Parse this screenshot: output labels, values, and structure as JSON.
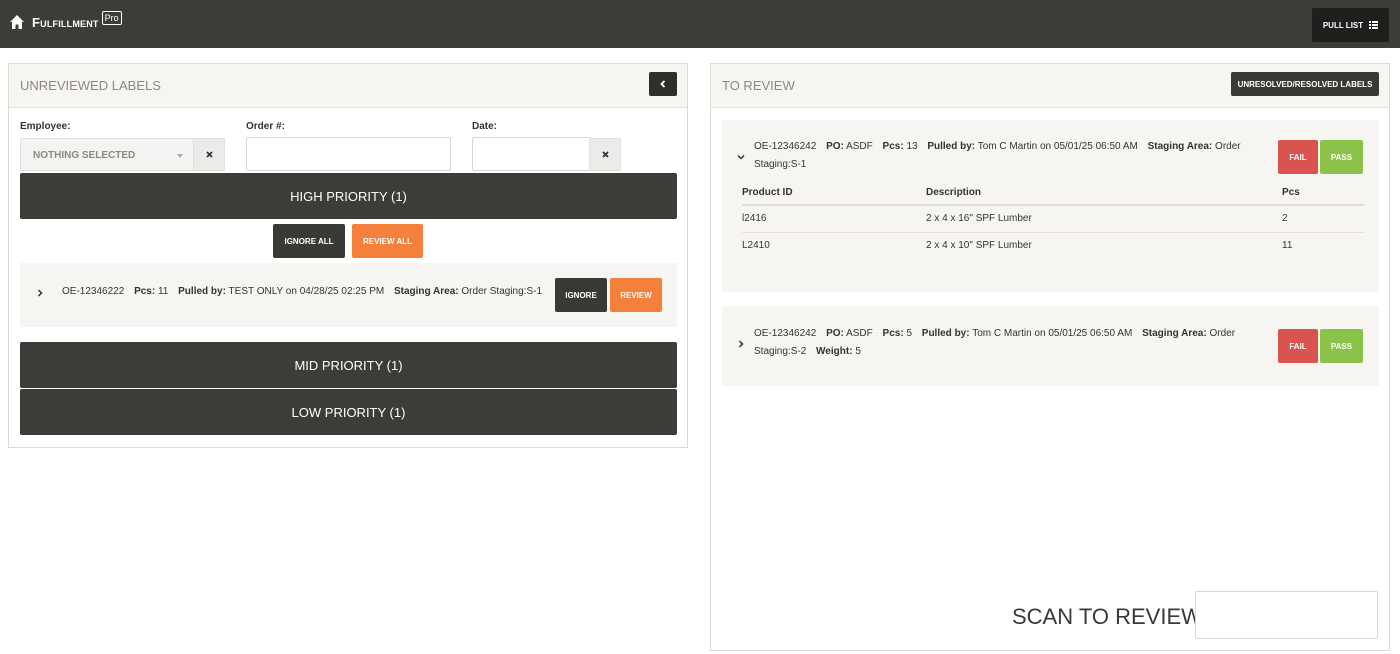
{
  "header": {
    "app_name": "Fulfillment",
    "badge": "Pro",
    "pull_list_label": "PULL LIST",
    "home_icon": "home-icon",
    "list_icon": "list-icon"
  },
  "unreviewed": {
    "title": "UNREVIEWED LABELS",
    "filters": {
      "employee_label": "Employee:",
      "employee_value": "NOTHING SELECTED",
      "order_label": "Order #:",
      "order_value": "",
      "date_label": "Date:",
      "date_value": ""
    },
    "high": {
      "label": "HIGH PRIORITY (1)",
      "ignore_all": "IGNORE ALL",
      "review_all": "REVIEW ALL",
      "items": [
        {
          "order": "OE-12346222",
          "pcs_label": "Pcs:",
          "pcs": "11",
          "pulled_label": "Pulled by:",
          "pulled": "TEST ONLY on 04/28/25 02:25 PM",
          "staging_label": "Staging Area:",
          "staging": "Order Staging:S-1",
          "ignore": "IGNORE",
          "review": "REVIEW"
        }
      ]
    },
    "mid": {
      "label": "MID PRIORITY (1)"
    },
    "low": {
      "label": "LOW PRIORITY (1)"
    }
  },
  "to_review": {
    "title": "TO REVIEW",
    "unresolved_button": "UNRESOLVED/RESOLVED LABELS",
    "items": [
      {
        "order": "OE-12346242",
        "po_label": "PO:",
        "po": "ASDF",
        "pcs_label": "Pcs:",
        "pcs": "13",
        "pulled_label": "Pulled by:",
        "pulled": "Tom C Martin on 05/01/25 06:50 AM",
        "staging_label": "Staging Area:",
        "staging_a": "Order",
        "staging_b": "Staging:S-1",
        "fail": "FAIL",
        "pass": "PASS",
        "table": {
          "headers": [
            "Product ID",
            "Description",
            "Pcs"
          ],
          "rows": [
            [
              "l2416",
              "2 x 4 x 16\" SPF Lumber",
              "2"
            ],
            [
              "L2410",
              "2 x 4 x 10\" SPF Lumber",
              "11"
            ]
          ]
        }
      },
      {
        "order": "OE-12346242",
        "po_label": "PO:",
        "po": "ASDF",
        "pcs_label": "Pcs:",
        "pcs": "5",
        "pulled_label": "Pulled by:",
        "pulled": "Tom C Martin on 05/01/25 06:50 AM",
        "staging_label": "Staging Area:",
        "staging_a": "Order",
        "staging_b": "Staging:S-2",
        "weight_label": "Weight:",
        "weight": "5",
        "fail": "FAIL",
        "pass": "PASS"
      }
    ],
    "scan_label": "SCAN TO REVIEW:",
    "scan_value": ""
  }
}
